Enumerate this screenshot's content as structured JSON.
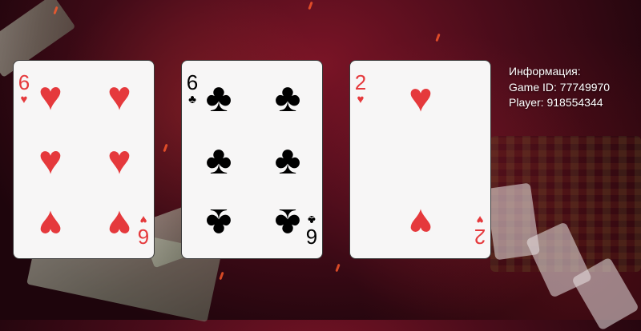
{
  "cards": [
    {
      "rank": "6",
      "suit": "♥",
      "suit_name": "hearts",
      "color": "#e5393c"
    },
    {
      "rank": "6",
      "suit": "♣",
      "suit_name": "clubs",
      "color": "#000000"
    },
    {
      "rank": "2",
      "suit": "♥",
      "suit_name": "hearts",
      "color": "#e5393c"
    }
  ],
  "info": {
    "heading": "Информация:",
    "game_id": "Game ID: 77749970",
    "player": "Player: 918554344"
  }
}
